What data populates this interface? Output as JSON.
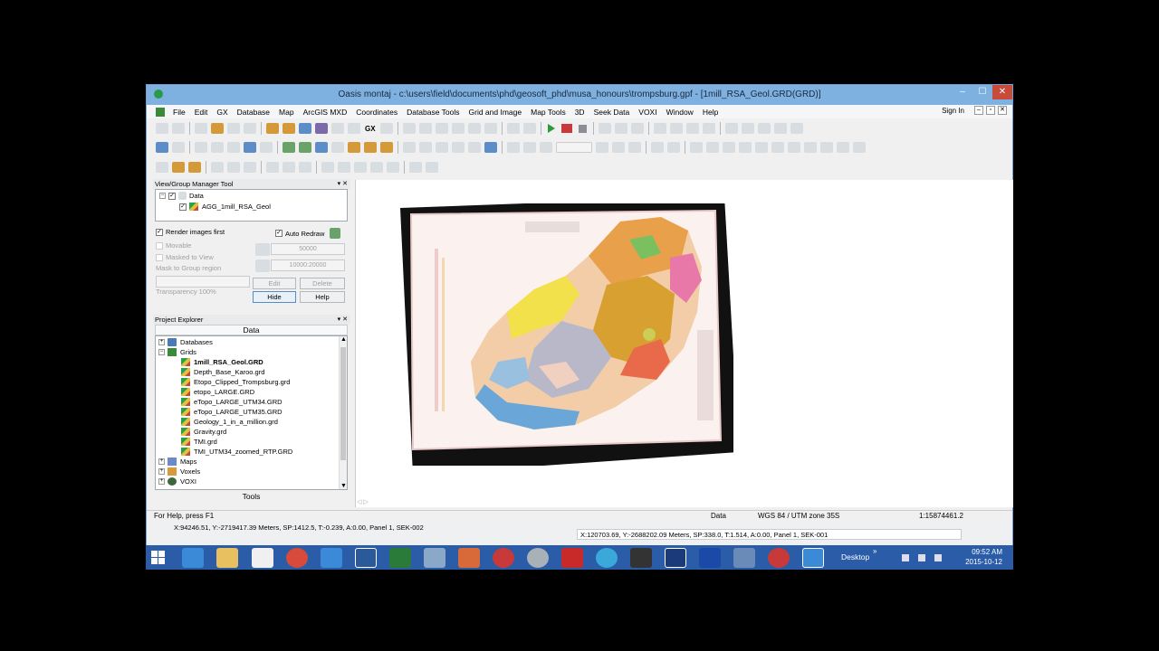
{
  "window": {
    "title": "Oasis montaj - c:\\users\\field\\documents\\phd\\geosoft_phd\\musa_honours\\trompsburg.gpf - [1mill_RSA_Geol.GRD(GRD)]",
    "min": "–",
    "max": "☐",
    "close": "✕"
  },
  "menu": {
    "items": [
      "File",
      "Edit",
      "GX",
      "Database",
      "Map",
      "ArcGIS MXD",
      "Coordinates",
      "Database Tools",
      "Grid and Image",
      "Map Tools",
      "3D",
      "Seek Data",
      "VOXI",
      "Window",
      "Help"
    ],
    "sign_in": "Sign In",
    "doc_min": "–",
    "doc_restore": "▫",
    "doc_close": "✕"
  },
  "toolbar2_gx": "GX",
  "vgm": {
    "title": "View/Group Manager Tool",
    "ctrls": "▾ ✕",
    "tree": [
      {
        "label": "Data",
        "checked": "✓"
      },
      {
        "label": "AGG_1mill_RSA_Geol",
        "checked": "✓"
      }
    ],
    "render_images_first": "Render images first",
    "auto_redraw": "Auto Redraw",
    "movable": "Movable",
    "masked_to_view": "Masked to View",
    "mask_to_group": "Mask to Group region",
    "transparency": "Transparency 100%",
    "scale1": "50000",
    "scale2": "10000:20000",
    "edit": "Edit",
    "delete": "Delete",
    "hide": "Hide",
    "help": "Help",
    "check": "✓",
    "expand_minus": "−"
  },
  "pe": {
    "title": "Project Explorer",
    "ctrls": "▾ ✕",
    "data_header": "Data",
    "tools": "Tools",
    "plus": "+",
    "minus": "−",
    "up": "▲",
    "down": "▼",
    "items": {
      "databases": "Databases",
      "grids": "Grids",
      "grid_files": [
        "1mill_RSA_Geol.GRD",
        "Depth_Base_Karoo.grd",
        "Etopo_Clipped_Trompsburg.grd",
        "etopo_LARGE.GRD",
        "eTopo_LARGE_UTM34.GRD",
        "eTopo_LARGE_UTM35.GRD",
        "Geology_1_in_a_million.grd",
        "Gravity.grd",
        "TMI.grd",
        "TMI_UTM34_zoomed_RTP.GRD"
      ],
      "maps": "Maps",
      "voxels": "Voxels",
      "voxi": "VOXI"
    }
  },
  "hscroll": "◁                                                                                                                                                                        ▷",
  "status": {
    "help": "For Help, press F1",
    "mode": "Data",
    "crs": "WGS 84 / UTM zone 35S",
    "scale": "1:15874461.2"
  },
  "status2": {
    "left": "X:94246.51, Y:-2719417.39 Meters,  SP:1412.5,  T:-0.239,  A:0.00,  Panel 1,  SEK-002",
    "right": "X:120703.69, Y:-2688202.09 Meters,  SP:338.0,  T:1.514,  A:0.00,  Panel 1,  SEK-001"
  },
  "taskbar": {
    "desktop": "Desktop",
    "chevron": "»",
    "time": "09:52 AM",
    "date": "2015-10-12",
    "tray_icons": [
      "flag-icon",
      "network-icon",
      "volume-icon"
    ]
  },
  "colors": {
    "titlebar": "#7eb0e0",
    "taskbar": "#2a5ca8",
    "accent_green": "#2a9a3a"
  }
}
